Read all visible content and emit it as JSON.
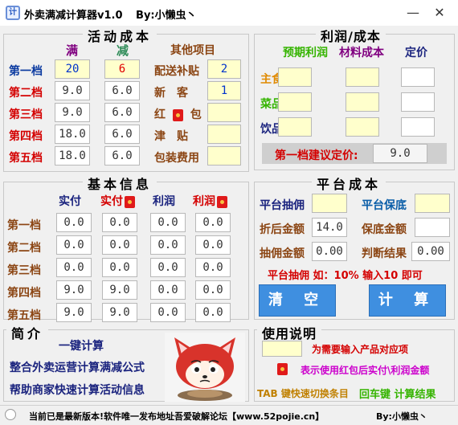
{
  "window": {
    "title": "外卖满减计算器v1.0",
    "author": "By:小懒虫丶",
    "min_icon": "minimize-icon",
    "close_icon": "close-icon"
  },
  "activity": {
    "legend": "活动成本",
    "col_full": "满",
    "col_minus": "减",
    "col_other": "其他项目",
    "tiers": [
      {
        "label": "第一档",
        "full": "20",
        "minus": "6"
      },
      {
        "label": "第二档",
        "full": "9.0",
        "minus": "6.0"
      },
      {
        "label": "第三档",
        "full": "9.0",
        "minus": "6.0"
      },
      {
        "label": "第四档",
        "full": "18.0",
        "minus": "6.0"
      },
      {
        "label": "第五档",
        "full": "18.0",
        "minus": "6.0"
      }
    ],
    "other": [
      {
        "label": "配送补贴",
        "value": "2"
      },
      {
        "label": "新　客",
        "value": "1"
      },
      {
        "label": "红",
        "label2": "包",
        "value": ""
      },
      {
        "label": "津　贴",
        "value": ""
      },
      {
        "label": "包装费用",
        "value": ""
      }
    ]
  },
  "profit": {
    "legend": "利润/成本",
    "col_expected": "预期利润",
    "col_material": "材料成本",
    "col_price": "定价",
    "rows": [
      "主食",
      "菜品",
      "饮品"
    ],
    "suggest_label": "第一档建议定价:",
    "suggest_value": "9.0"
  },
  "basic": {
    "legend": "基本信息",
    "cols": [
      "实付",
      "实付",
      "利润",
      "利润"
    ],
    "rows": [
      {
        "label": "第一档",
        "v": [
          "0.0",
          "0.0",
          "0.0",
          "0.0"
        ]
      },
      {
        "label": "第二档",
        "v": [
          "0.0",
          "0.0",
          "0.0",
          "0.0"
        ]
      },
      {
        "label": "第三档",
        "v": [
          "0.0",
          "0.0",
          "0.0",
          "0.0"
        ]
      },
      {
        "label": "第四档",
        "v": [
          "9.0",
          "9.0",
          "0.0",
          "0.0"
        ]
      },
      {
        "label": "第五档",
        "v": [
          "9.0",
          "9.0",
          "0.0",
          "0.0"
        ]
      }
    ]
  },
  "platform": {
    "legend": "平台成本",
    "commission_label": "平台抽佣",
    "guarantee_label": "平台保底",
    "discount_label": "折后金额",
    "discount_value": "14.0",
    "guarantee_amount_label": "保底金额",
    "commission_amount_label": "抽佣金额",
    "commission_amount_value": "0.00",
    "judge_label": "判断结果",
    "judge_value": "0.00",
    "hint": "平台抽佣 如：10% 输入10 即可",
    "clear_button": "清 空",
    "calc_button": "计 算"
  },
  "intro": {
    "legend": "简介",
    "line1": "一键计算",
    "line2": "整合外卖运营计算满减公式",
    "line3": "帮助商家快速计算活动信息"
  },
  "usage": {
    "legend": "使用说明",
    "line1": "为需要输入产品对应项",
    "line2": "表示使用红包后实付\\利润金额",
    "line3_a": "TAB 键快速切换条目",
    "line3_b": "回车键 计算结果"
  },
  "status": {
    "text": "当前已是最新版本!软件唯一发布地址吾爱破解论坛【www.52pojie.cn】",
    "author": "By:小懒虫丶"
  },
  "colors": {
    "accent_button": "#3f8fe0",
    "input_yellow": "#ffffcc",
    "label_red": "#d40000"
  }
}
